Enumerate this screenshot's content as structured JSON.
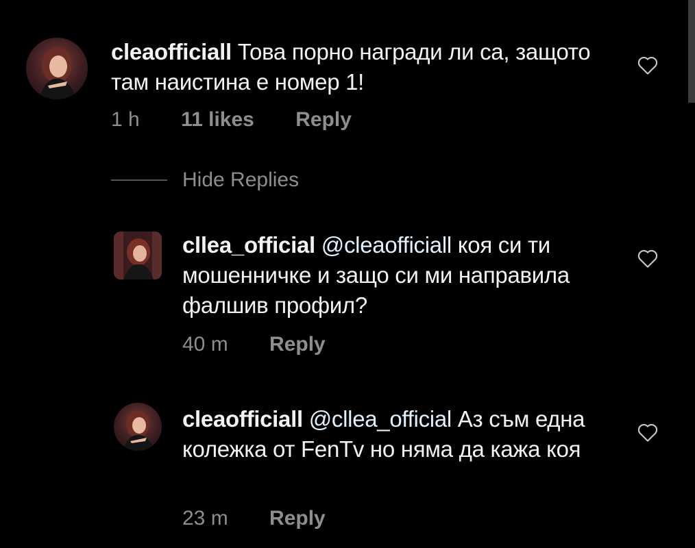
{
  "comments": [
    {
      "username": "cleaofficiall",
      "mention": "",
      "text": "Това порно награди ли са, защото там наистина е номер 1!",
      "time": "1 h",
      "likes": "11 likes",
      "reply": "Reply"
    }
  ],
  "replies_toggle": "Hide Replies",
  "replies": [
    {
      "username": "cllea_official",
      "mention": "@cleaofficiall",
      "text": "коя си ти мошенничке и защо си ми направила фалшив профил?",
      "time": "40 m",
      "reply": "Reply"
    },
    {
      "username": "cleaofficiall",
      "mention": "@cllea_official",
      "text": "Аз съм една колежка от FenTv но няма да кажа коя",
      "time": "23 m",
      "reply": "Reply"
    }
  ],
  "icons": {
    "like": "heart-outline-icon"
  }
}
